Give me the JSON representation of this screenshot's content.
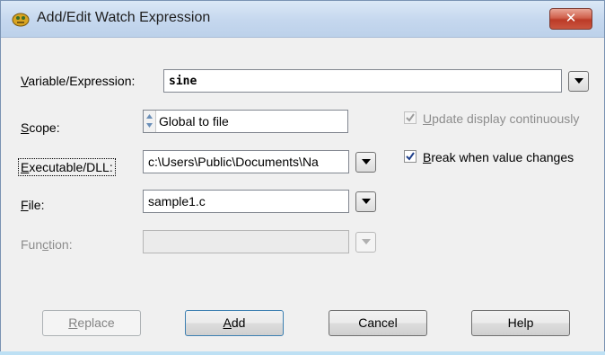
{
  "window": {
    "title": "Add/Edit Watch Expression",
    "close_label": "✕",
    "app_icon": "cvi-app-icon"
  },
  "form": {
    "variable": {
      "prefix": "",
      "accel": "V",
      "rest": "ariable/Expression:",
      "value": "sine"
    },
    "scope": {
      "accel": "S",
      "rest": "cope:",
      "value": "Global to file"
    },
    "executable": {
      "accel": "E",
      "rest": "xecutable/DLL:",
      "value": "c:\\Users\\Public\\Documents\\Na"
    },
    "file": {
      "accel": "F",
      "rest": "ile:",
      "value": "sample1.c"
    },
    "function": {
      "before": "Fun",
      "accel": "c",
      "after": "tion:",
      "value": ""
    }
  },
  "options": {
    "update_display": {
      "accel": "U",
      "rest": "pdate display continuously",
      "checked": true,
      "enabled": false
    },
    "break_on_change": {
      "accel": "B",
      "rest": "reak when value changes",
      "checked": true,
      "enabled": true
    }
  },
  "buttons": {
    "replace": {
      "accel": "R",
      "rest": "eplace"
    },
    "add": {
      "accel": "A",
      "rest": "dd"
    },
    "cancel": {
      "label": "Cancel"
    },
    "help": {
      "label": "Help"
    }
  }
}
